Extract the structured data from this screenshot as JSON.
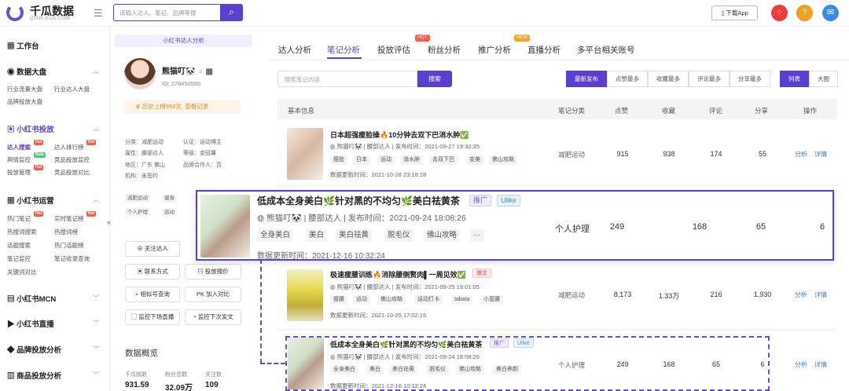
{
  "app": {
    "brand": "千瓜数据",
    "brand_sub": "QIAN-GUA.COM"
  },
  "topbar": {
    "search_placeholder": "请输入达人、笔记、品牌等搜",
    "download_label": "下载App"
  },
  "sidebar": {
    "workbench": "工作台",
    "groups": [
      {
        "title": "数据大盘",
        "items": [
          "行业流量大盘",
          "行业达人大盘",
          "品牌投放大盘"
        ]
      },
      {
        "title": "小红书投放",
        "items": [
          "达人搜索",
          "达人排行榜",
          "舆情监控",
          "竞品投放监控",
          "投放管理",
          "竞品投放对比"
        ]
      },
      {
        "title": "小红书运营",
        "items": [
          "热门笔记",
          "实时笔记榜",
          "热搜词搜索",
          "热搜词榜",
          "话题搜索",
          "热门话题榜",
          "笔记监控",
          "笔记收录查询",
          "关键词对比"
        ]
      },
      {
        "title": "小红书MCN"
      },
      {
        "title": "小红书直播"
      },
      {
        "title": "品牌投放分析"
      },
      {
        "title": "商品投放分析"
      }
    ],
    "badges": {
      "hot": "Hot",
      "beta": "Beta"
    }
  },
  "profile": {
    "header": "小红书达人分析",
    "nickname": "熊猫叮🐼",
    "id_label": "ID: 278450585",
    "history": "历史上榜992次, 查看记录",
    "fields": {
      "gender": "分类：减肥运动",
      "cert": "认证：运动博主",
      "attr": "属性：腰部达人",
      "level": "等级：金冠薯",
      "region": "地区：广东 佛山",
      "partner": "品牌合作人：否",
      "org": "机构：未签约"
    },
    "tags": [
      "减肥运动",
      "健身",
      "个人护理",
      "运动"
    ],
    "buttons": {
      "follow": "关注达人",
      "contact": "联系方式",
      "report": "投放报价",
      "similar": "相似号查询",
      "pk": "PK 加入对比",
      "monitor_live": "监控下场直播",
      "monitor_note": "监控下次发文"
    },
    "stats_title": "数据概览",
    "stats": [
      {
        "label": "千瓜指数",
        "value": "931.59"
      },
      {
        "label": "粉丝总数",
        "value": "32.09万"
      },
      {
        "label": "关注数",
        "value": "109"
      }
    ]
  },
  "tabs": [
    {
      "label": "达人分析"
    },
    {
      "label": "笔记分析",
      "active": true
    },
    {
      "label": "投放评估",
      "badge": "HOT"
    },
    {
      "label": "粉丝分析"
    },
    {
      "label": "推广分析",
      "badge": "NEW"
    },
    {
      "label": "直播分析"
    },
    {
      "label": "多平台相关账号"
    }
  ],
  "filters": {
    "keyword_placeholder": "搜索笔记内容",
    "search_label": "搜索",
    "sorts": [
      "最新发布",
      "点赞最多",
      "收藏最多",
      "评论最多",
      "分享最多"
    ],
    "views": [
      "列表",
      "大图"
    ]
  },
  "table": {
    "headers": [
      "基本信息",
      "笔记分类",
      "点赞",
      "收藏",
      "评论",
      "分享",
      "操作"
    ],
    "actions": [
      "分析",
      "详情"
    ],
    "rows": [
      {
        "title": "日本超强瘦脸操🔥10分钟去双下巴消水肿✅",
        "author": "熊猫叮🐼",
        "level": "腰部达人",
        "time": "发布时间：2021-09-27 19:32:35",
        "tags": [
          "瘦脸",
          "日本",
          "运动",
          "消水肿",
          "去双下巴",
          "变美",
          "佛山攻略"
        ],
        "update": "数据更新时间：2021-10-28 23:18:28",
        "category": "减肥运动",
        "likes": "915",
        "collects": "938",
        "comments": "174",
        "shares": "55"
      },
      {
        "title": "低成本全身美白🌿针对黑的不均匀🌿美白祛黄茶",
        "badges": [
          "推广",
          "Ulike"
        ],
        "author": "熊猫叮🐼",
        "level": "腰部达人",
        "time": "发布时间：2021-09-24 18:08:26",
        "tags": [
          "全身美白",
          "美白",
          "美白祛黄",
          "脱毛仪",
          "佛山攻略",
          "···"
        ],
        "update": "数据更新时间：2021-12-16 10:32:24",
        "category": "个人护理",
        "likes": "249",
        "collects": "168",
        "comments": "65",
        "shares": "6"
      },
      {
        "title": "极速瘦腰训练🔥消除腰侧赘肉▌一周见效✅",
        "badges": [
          "爆文"
        ],
        "author": "熊猫叮🐼",
        "level": "腰部达人",
        "time": "发布时间：2021-09-25 19:01:05",
        "tags": [
          "瘦腰",
          "运动",
          "佛山攻略",
          "运动打卡",
          "tabata",
          "小蛮腰"
        ],
        "update": "数据更新时间：2021-10-25 17:02:15",
        "category": "减肥运动",
        "likes": "8,173",
        "collects": "1.33万",
        "comments": "216",
        "shares": "1,930"
      },
      {
        "title": "低成本全身美白🌿针对黑的不均匀🌿美白祛黄茶",
        "badges": [
          "推广",
          "Ulike"
        ],
        "author": "熊猫叮🐼",
        "level": "腰部达人",
        "time": "发布时间：2021-09-24 18:08:26",
        "tags": [
          "全身美白",
          "美白",
          "美白祛黄",
          "脱毛仪",
          "佛山攻略",
          "美白养颜"
        ],
        "update": "数据更新时间：2021-12-16 10:12:24",
        "category": "个人护理",
        "likes": "249",
        "collects": "168",
        "comments": "65",
        "shares": "6"
      }
    ]
  },
  "colors": {
    "accent": "#5b3fd0",
    "link": "#3c7bd8",
    "hot": "#ff5a4a"
  }
}
